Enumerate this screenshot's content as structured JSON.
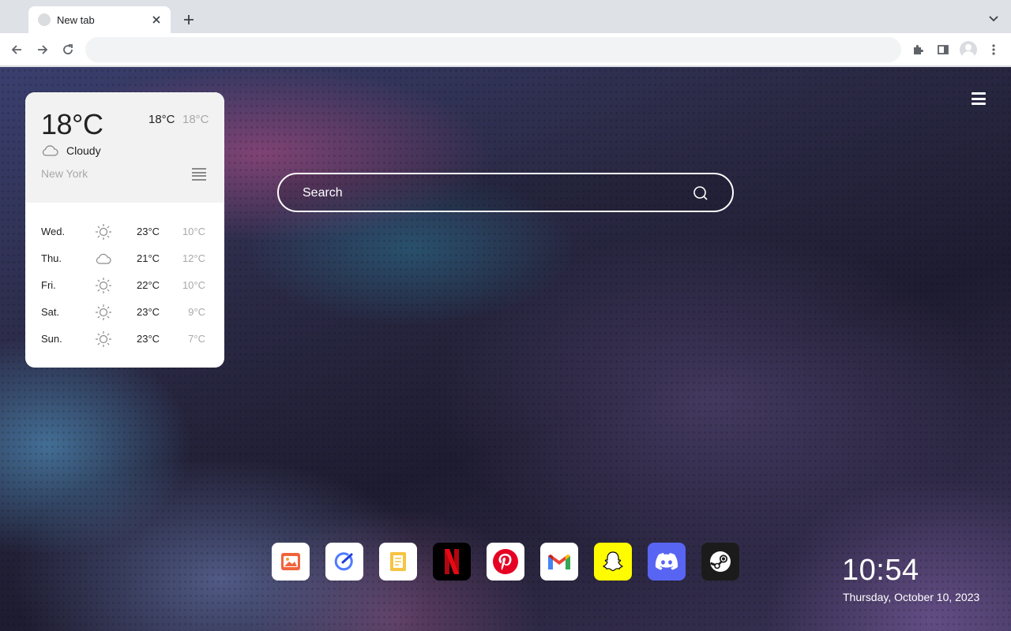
{
  "browser": {
    "tab_title": "New tab",
    "address_value": ""
  },
  "weather": {
    "current_temp": "18°C",
    "high": "18°C",
    "low": "18°C",
    "condition": "Cloudy",
    "condition_icon": "cloud-icon",
    "city": "New York",
    "forecast": [
      {
        "day": "Wed.",
        "icon": "sun-icon",
        "high": "23°C",
        "low": "10°C"
      },
      {
        "day": "Thu.",
        "icon": "cloud-icon",
        "high": "21°C",
        "low": "12°C"
      },
      {
        "day": "Fri.",
        "icon": "sun-icon",
        "high": "22°C",
        "low": "10°C"
      },
      {
        "day": "Sat.",
        "icon": "sun-icon",
        "high": "23°C",
        "low": "9°C"
      },
      {
        "day": "Sun.",
        "icon": "sun-icon",
        "high": "23°C",
        "low": "7°C"
      }
    ]
  },
  "search": {
    "placeholder": "Search"
  },
  "dock": {
    "apps": [
      {
        "name": "Gallery",
        "icon": "gallery-icon",
        "color": "#ffffff"
      },
      {
        "name": "Tasks",
        "icon": "tasks-icon",
        "color": "#ffffff"
      },
      {
        "name": "Notes",
        "icon": "notes-icon",
        "color": "#ffffff"
      },
      {
        "name": "Netflix",
        "icon": "netflix-icon",
        "color": "#000000"
      },
      {
        "name": "Pinterest",
        "icon": "pinterest-icon",
        "color": "#ffffff"
      },
      {
        "name": "Gmail",
        "icon": "gmail-icon",
        "color": "#ffffff"
      },
      {
        "name": "Snapchat",
        "icon": "snapchat-icon",
        "color": "#fffc00"
      },
      {
        "name": "Discord",
        "icon": "discord-icon",
        "color": "#5865f2"
      },
      {
        "name": "Steam",
        "icon": "steam-icon",
        "color": "#1b1b1b"
      }
    ]
  },
  "clock": {
    "time": "10:54",
    "date": "Thursday, October 10, 2023"
  }
}
